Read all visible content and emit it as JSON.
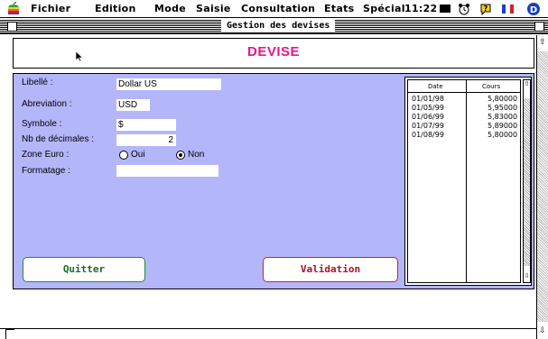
{
  "menubar": {
    "items": [
      "Fichier",
      "Edition",
      "Mode",
      "Saisie",
      "Consultation",
      "Etats",
      "Spécial"
    ],
    "clock": "11:22"
  },
  "window": {
    "title": "Gestion des devises"
  },
  "header": {
    "title": "DEVISE"
  },
  "form": {
    "libelle_label": "Libellé :",
    "libelle_value": "Dollar US",
    "abreviation_label": "Abreviation :",
    "abreviation_value": "USD",
    "symbole_label": "Symbole :",
    "symbole_value": "$",
    "decimales_label": "Nb de décimales :",
    "decimales_value": "2",
    "zone_label": "Zone Euro :",
    "zone_oui": "Oui",
    "zone_non": "Non",
    "zone_selected": "Non",
    "formatage_label": "Formatage :",
    "formatage_value": ""
  },
  "table": {
    "headers": [
      "Date",
      "Cours"
    ],
    "rows": [
      [
        "01/01/98",
        "5,80000"
      ],
      [
        "01/05/99",
        "5,95000"
      ],
      [
        "01/06/99",
        "5,83000"
      ],
      [
        "01/07/99",
        "5,89000"
      ],
      [
        "01/08/99",
        "5,80000"
      ]
    ]
  },
  "buttons": {
    "quit": "Quitter",
    "validate": "Validation"
  },
  "colors": {
    "form_bg": "#b4b6fa",
    "header_title": "#e8168a",
    "quit_border": "#1f8a3a",
    "validate_border": "#d0202e",
    "validate_text": "#b0102a",
    "quit_text": "#1f6b2f"
  }
}
